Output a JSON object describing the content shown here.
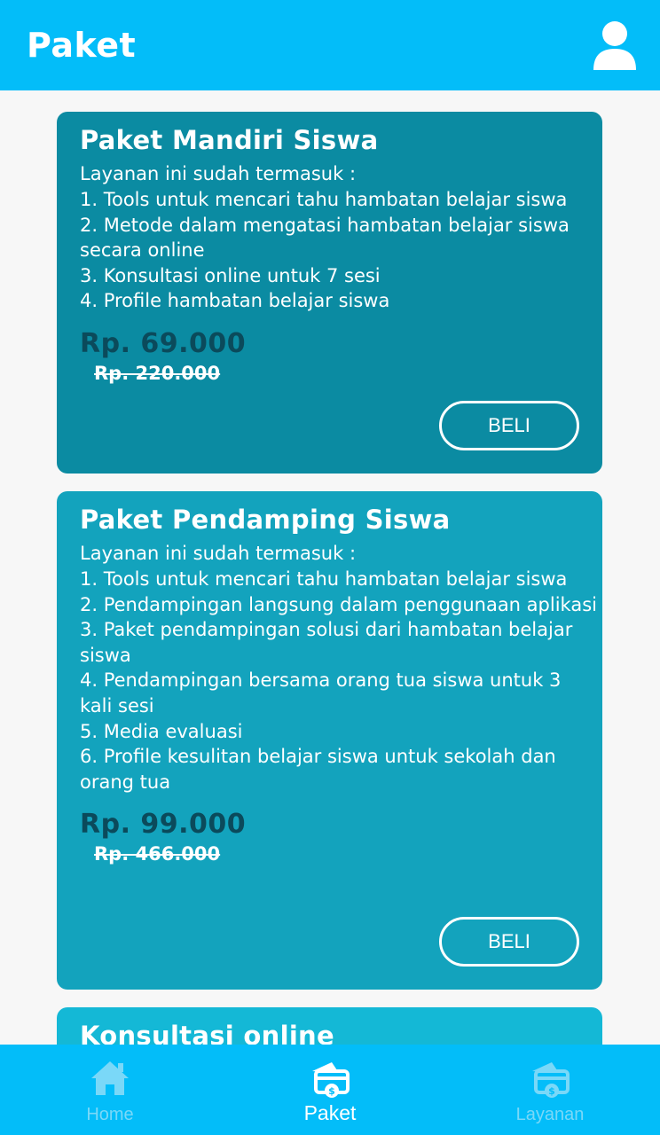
{
  "appbar": {
    "title": "Paket",
    "profile_icon": "person-icon",
    "color": "#03bdf9"
  },
  "packages": [
    {
      "title": "Paket Mandiri Siswa",
      "intro": "Layanan ini sudah termasuk :",
      "features": [
        "1.  Tools untuk mencari tahu hambatan belajar siswa",
        "2. Metode dalam mengatasi hambatan belajar siswa secara online",
        "3. Konsultasi online untuk 7 sesi",
        "4. Profile hambatan belajar siswa"
      ],
      "price": "Rp. 69.000",
      "old_price": "Rp. 220.000",
      "button": "BELI",
      "color": "#0b8ba2"
    },
    {
      "title": "Paket Pendamping Siswa",
      "intro": "Layanan ini sudah termasuk :",
      "features": [
        "1. Tools untuk mencari tahu hambatan belajar siswa",
        "2. Pendampingan langsung dalam penggunaan aplikasi",
        "3. Paket pendampingan solusi dari hambatan belajar siswa",
        "4. Pendampingan bersama orang tua siswa untuk 3 kali sesi",
        "5. Media evaluasi",
        "6. Profile kesulitan belajar siswa untuk sekolah dan orang tua"
      ],
      "price": "Rp. 99.000",
      "old_price": "Rp. 466.000",
      "button": "BELI",
      "color": "#13a3bd"
    },
    {
      "title": "Konsultasi online",
      "color": "#14b8d6"
    }
  ],
  "bottom_nav": [
    {
      "label": "Home",
      "icon": "home-icon",
      "active": false
    },
    {
      "label": "Paket",
      "icon": "package-icon",
      "active": true
    },
    {
      "label": "Layanan",
      "icon": "services-icon",
      "active": false
    }
  ],
  "colors": {
    "nav_active": "#ffffff",
    "nav_inactive": "#7ad8f8",
    "price": "#0b4a5b"
  }
}
